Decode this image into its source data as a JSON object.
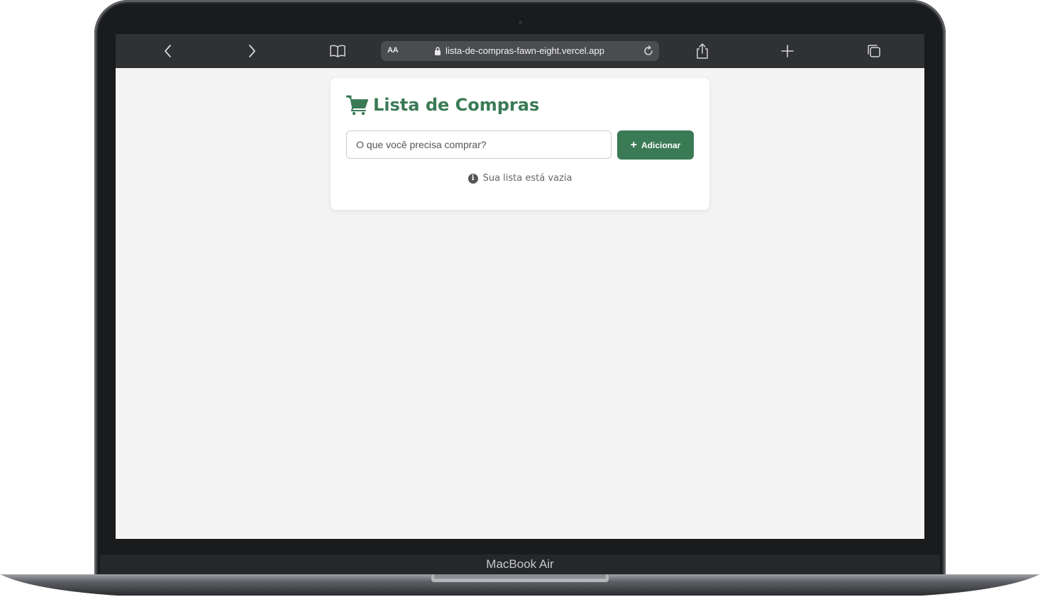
{
  "device": {
    "label": "MacBook Air"
  },
  "browser": {
    "address_bar": {
      "reader_label": "AA",
      "url": "lista-de-compras-fawn-eight.vercel.app"
    },
    "icons": [
      "chevron-left-icon",
      "chevron-right-icon",
      "book-icon",
      "lock-icon",
      "reload-icon",
      "share-icon",
      "plus-icon",
      "tabs-icon"
    ],
    "toolbar_color": "#2f3133"
  },
  "app": {
    "title": "Lista de Compras",
    "title_icon": "cart-icon",
    "input": {
      "value": "",
      "placeholder": "O que você precisa comprar?"
    },
    "add_button": {
      "icon": "+",
      "label": "Adicionar"
    },
    "empty_message": "Sua lista está vazia",
    "empty_icon": "info-icon",
    "accent_color": "#3a7a55",
    "background_color": "#f4f4f4"
  }
}
